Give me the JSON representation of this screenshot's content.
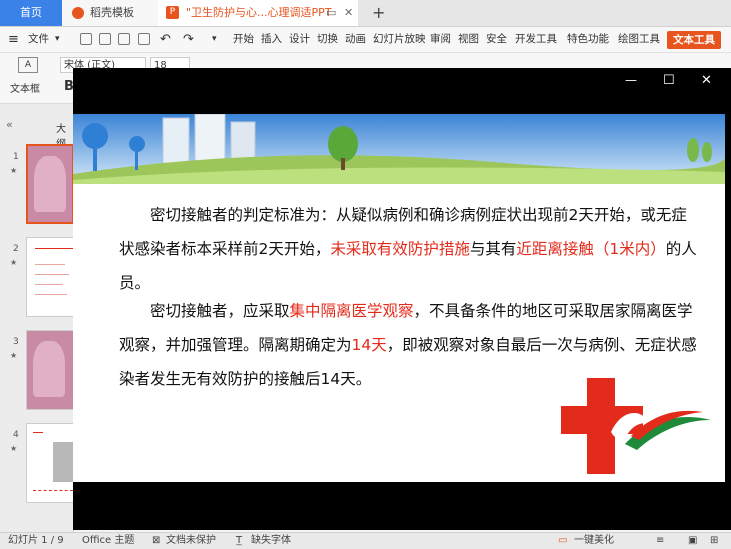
{
  "tabs": {
    "home": "首页",
    "template": "稻壳模板",
    "doc": "\"卫生防护与心...心理调适PPT"
  },
  "menu": [
    "文件",
    "开始",
    "插入",
    "设计",
    "切换",
    "动画",
    "幻灯片放映",
    "审阅",
    "视图",
    "安全",
    "开发工具",
    "特色功能",
    "绘图工具",
    "文本工具"
  ],
  "ribbon": {
    "textbox_label": "文本框",
    "font_name": "宋体 (正文)",
    "font_size": "18",
    "bold": "B",
    "panel_title": "大纲"
  },
  "slide": {
    "p1_a": "密切接触者的判定标准为：从疑似病例和确诊病例症状出现前2天开始，或无症状感染者标本采样前2天开始，",
    "p1_b": "未采取有效防护措施",
    "p1_c": "与其有",
    "p1_d": "近距离接触（1米内）",
    "p1_e": "的人员。",
    "p2_a": "密切接触者，应采取",
    "p2_b": "集中隔离医学观察",
    "p2_c": "，不具备条件的地区可采取居家隔离医学观察，并加强管理。隔离期确定为",
    "p2_d": "14天",
    "p2_e": "，即被观察对象自最后一次与病例、无症状感染者发生无有效防护的接触后14天。"
  },
  "thumbnails": [
    "1",
    "2",
    "3",
    "4"
  ],
  "status": {
    "slide_count": "幻灯片 1 / 9",
    "theme": "Office 主题",
    "protect": "文档未保护",
    "font_missing": "缺失字体",
    "beautify": "一键美化"
  },
  "colors": {
    "accent": "#e8541e",
    "home_tab": "#3a82e8",
    "highlight_red": "#e32b1c"
  }
}
